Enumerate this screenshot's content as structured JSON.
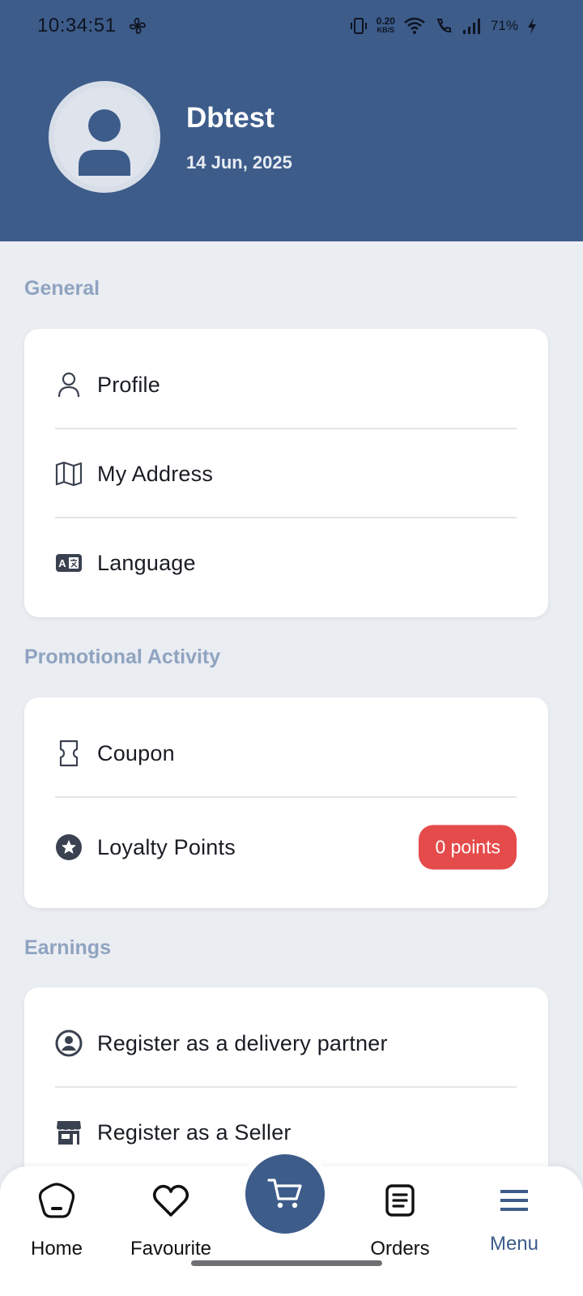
{
  "status_bar": {
    "time": "10:34:51",
    "net_speed_value": "0.20",
    "net_speed_unit": "KB/S",
    "battery": "71%"
  },
  "profile": {
    "name": "Dbtest",
    "date": "14 Jun, 2025"
  },
  "sections": {
    "general": {
      "title": "General",
      "items": [
        {
          "label": "Profile",
          "icon": "person-icon"
        },
        {
          "label": "My Address",
          "icon": "map-icon"
        },
        {
          "label": "Language",
          "icon": "translate-icon"
        }
      ]
    },
    "promotional": {
      "title": "Promotional Activity",
      "items": [
        {
          "label": "Coupon",
          "icon": "ticket-icon"
        },
        {
          "label": "Loyalty Points",
          "icon": "star-badge-icon",
          "badge": "0 points"
        }
      ]
    },
    "earnings": {
      "title": "Earnings",
      "items": [
        {
          "label": "Register as a delivery partner",
          "icon": "account-circle-icon"
        },
        {
          "label": "Register as a Seller",
          "icon": "store-icon"
        }
      ]
    }
  },
  "bottom_nav": {
    "home": "Home",
    "favourite": "Favourite",
    "orders": "Orders",
    "menu": "Menu",
    "active": "Menu"
  },
  "colors": {
    "header": "#3d5c8a",
    "background": "#eaedf2",
    "section_title": "#8fa3c0",
    "badge": "#e54b4b"
  }
}
